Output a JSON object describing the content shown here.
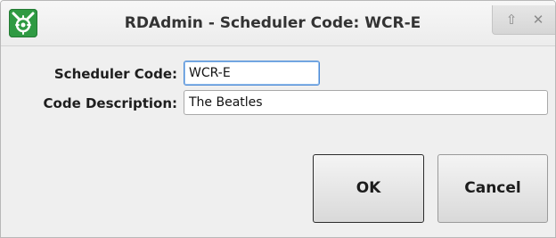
{
  "window": {
    "title": "RDAdmin - Scheduler Code: WCR-E",
    "app_icon": "rdadmin-app-icon",
    "controls": {
      "raise_icon": "⇧",
      "close_icon": "✕"
    }
  },
  "form": {
    "scheduler_code_label": "Scheduler Code:",
    "scheduler_code_value": "WCR-E",
    "code_description_label": "Code Description:",
    "code_description_value": "The Beatles"
  },
  "buttons": {
    "ok_label": "OK",
    "cancel_label": "Cancel"
  },
  "colors": {
    "icon_green": "#2f9a43",
    "focus_blue": "#4b8ad6",
    "window_bg": "#efefef"
  }
}
